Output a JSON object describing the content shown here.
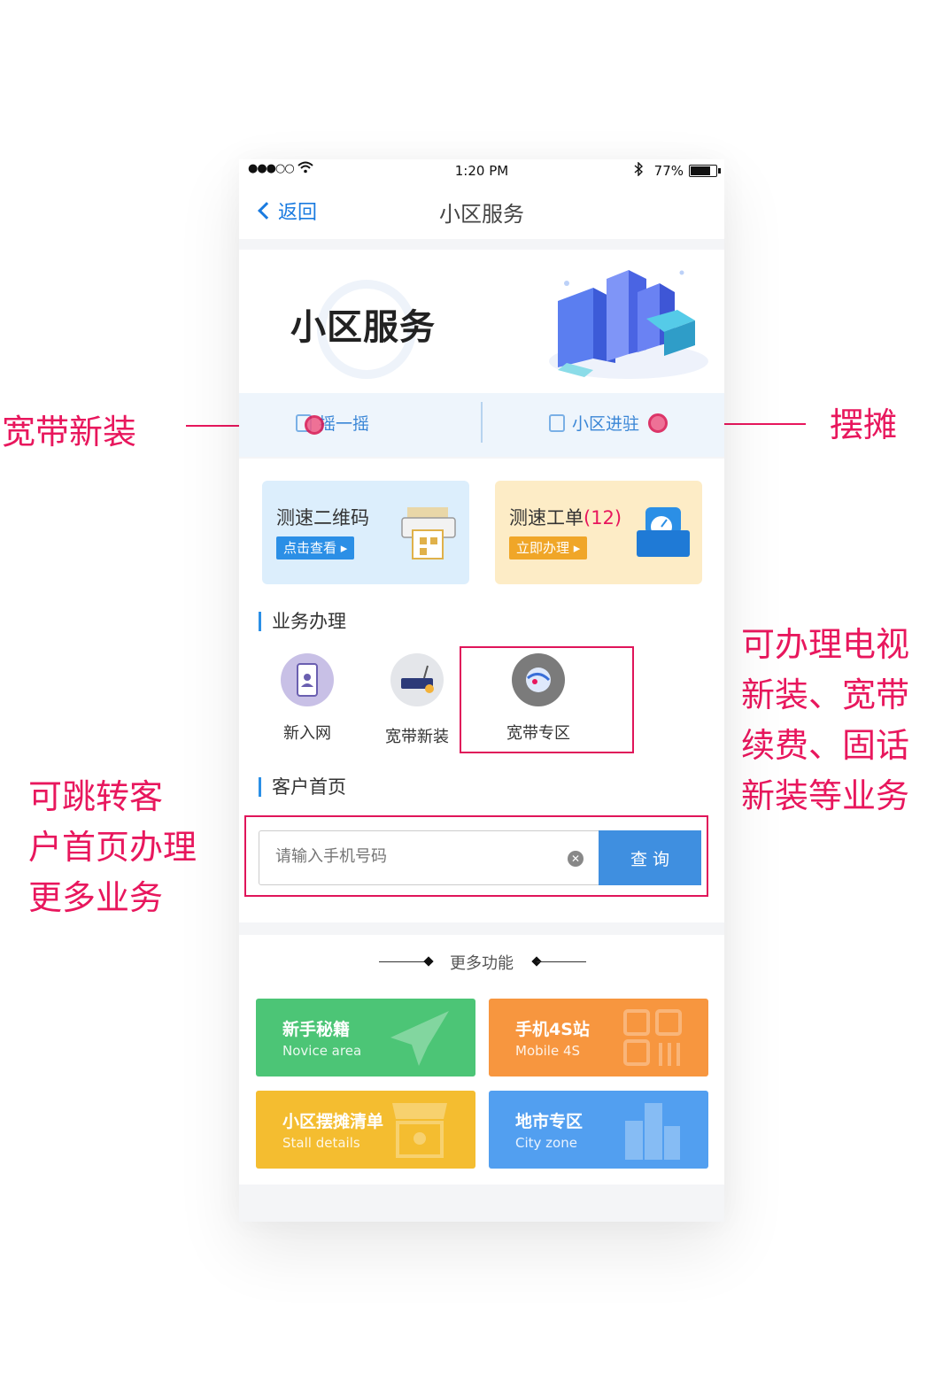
{
  "annotations": {
    "left_top": "宽带新装",
    "right_top": "摆摊",
    "right_lines": [
      "可办理电视",
      "新装、宽带",
      "续费、固话",
      "新装等业务"
    ],
    "left_lines": [
      "可跳转客",
      "户首页办理",
      "更多业务"
    ]
  },
  "status": {
    "signal": "●●●○○",
    "time": "1:20 PM",
    "battery": "77%"
  },
  "nav": {
    "back": "返回",
    "title": "小区服务"
  },
  "hero": {
    "title": "小区服务"
  },
  "actions": {
    "shake": "摇一摇",
    "settle": "小区进驻"
  },
  "cards": [
    {
      "title": "测速二维码",
      "count": "",
      "button": "点击查看"
    },
    {
      "title": "测速工单",
      "count": "(12)",
      "button": "立即办理"
    }
  ],
  "business": {
    "title": "业务办理",
    "items": [
      {
        "label": "新入网",
        "icon": "phone-user-icon"
      },
      {
        "label": "宽带新装",
        "icon": "router-icon"
      },
      {
        "label": "宽带专区",
        "icon": "globe-icon"
      }
    ]
  },
  "customer": {
    "title": "客户首页",
    "placeholder": "请输入手机号码",
    "button": "查 询"
  },
  "more": {
    "title": "更多功能",
    "tiles": [
      {
        "title": "新手秘籍",
        "sub": "Novice area",
        "color": "#4cc576",
        "icon": "paper-plane-icon"
      },
      {
        "title": "手机4S站",
        "sub": "Mobile 4S",
        "color": "#f7963f",
        "icon": "grid-icon"
      },
      {
        "title": "小区摆摊清单",
        "sub": "Stall details",
        "color": "#f4bd30",
        "icon": "shop-icon"
      },
      {
        "title": "地市专区",
        "sub": "City zone",
        "color": "#529ff0",
        "icon": "buildings-icon"
      }
    ]
  }
}
